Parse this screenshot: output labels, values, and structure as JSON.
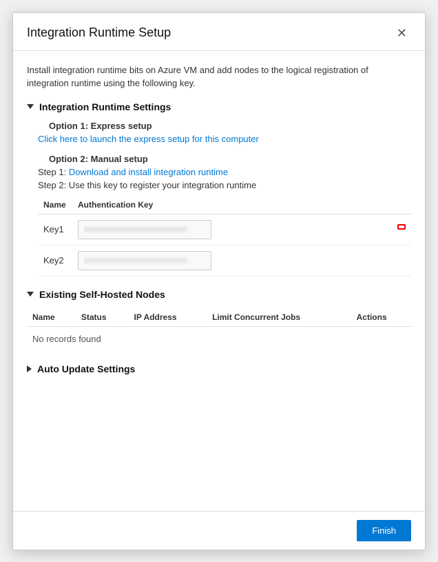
{
  "dialog": {
    "title": "Integration Runtime Setup",
    "close_label": "✕",
    "description": "Install integration runtime bits on Azure VM and add nodes to the logical registration of integration runtime using the following key.",
    "sections": {
      "runtime_settings": {
        "label": "Integration Runtime Settings",
        "expanded": true,
        "option1": {
          "title": "Option 1: Express setup",
          "link_text": "Click here to launch the express setup for this computer"
        },
        "option2": {
          "title": "Option 2: Manual setup",
          "step1_prefix": "Step 1: ",
          "step1_link": "Download and install integration runtime",
          "step2_text": "Step 2: Use this key to register your integration runtime"
        },
        "keys_table": {
          "col_name": "Name",
          "col_auth_key": "Authentication Key",
          "rows": [
            {
              "name": "Key1",
              "value": "•••••••••••••••••••••••••••••••••••••••••••••••••••••••••••••••"
            },
            {
              "name": "Key2",
              "value": "•••••••••••••••••••••••••••••••••••••••••••••••••••••"
            }
          ]
        }
      },
      "self_hosted_nodes": {
        "label": "Existing Self-Hosted Nodes",
        "expanded": true,
        "col_name": "Name",
        "col_status": "Status",
        "col_ip": "IP Address",
        "col_limit": "Limit Concurrent Jobs",
        "col_actions": "Actions",
        "no_records": "No records found"
      },
      "auto_update": {
        "label": "Auto Update Settings",
        "expanded": false
      }
    },
    "footer": {
      "finish_label": "Finish"
    }
  }
}
